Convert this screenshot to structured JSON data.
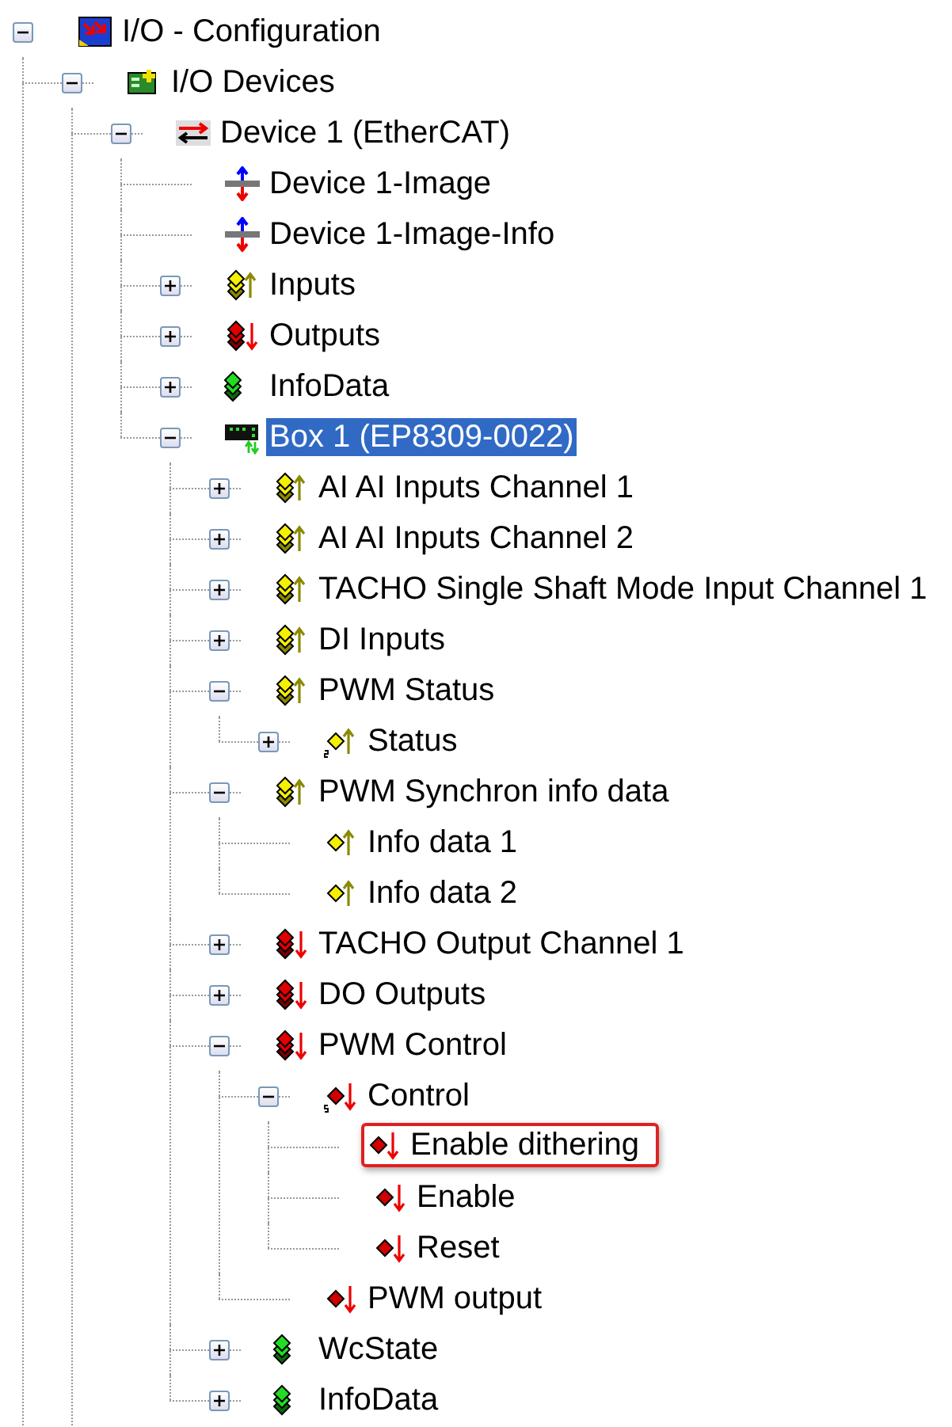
{
  "tree": [
    {
      "label": "I/O - Configuration",
      "kind": "config",
      "expanded": true,
      "selected": false,
      "children": [
        {
          "label": "I/O Devices",
          "kind": "devices",
          "expanded": true,
          "selected": false,
          "children": [
            {
              "label": "Device 1 (EtherCAT)",
              "kind": "ethercat",
              "expanded": true,
              "selected": false,
              "children": [
                {
                  "label": "Device 1-Image",
                  "kind": "image",
                  "selected": false
                },
                {
                  "label": "Device 1-Image-Info",
                  "kind": "image",
                  "selected": false
                },
                {
                  "label": "Inputs",
                  "kind": "inputs",
                  "expanded": false,
                  "selected": false
                },
                {
                  "label": "Outputs",
                  "kind": "outputs",
                  "expanded": false,
                  "selected": false
                },
                {
                  "label": "InfoData",
                  "kind": "info",
                  "expanded": false,
                  "selected": false
                },
                {
                  "label": "Box 1 (EP8309-0022)",
                  "kind": "box",
                  "expanded": true,
                  "selected": true,
                  "children": [
                    {
                      "label": "AI AI Inputs Channel 1",
                      "kind": "inputs",
                      "expanded": false,
                      "selected": false
                    },
                    {
                      "label": "AI AI Inputs Channel 2",
                      "kind": "inputs",
                      "expanded": false,
                      "selected": false
                    },
                    {
                      "label": "TACHO Single Shaft Mode Input Channel 1",
                      "kind": "inputs",
                      "expanded": false,
                      "selected": false
                    },
                    {
                      "label": "DI Inputs",
                      "kind": "inputs",
                      "expanded": false,
                      "selected": false
                    },
                    {
                      "label": "PWM Status",
                      "kind": "inputs",
                      "expanded": true,
                      "selected": false,
                      "children": [
                        {
                          "label": "Status",
                          "kind": "input_struct",
                          "expanded": false,
                          "selected": false
                        }
                      ]
                    },
                    {
                      "label": "PWM Synchron info data",
                      "kind": "inputs",
                      "expanded": true,
                      "selected": false,
                      "children": [
                        {
                          "label": "Info data 1",
                          "kind": "input_var",
                          "selected": false
                        },
                        {
                          "label": "Info data 2",
                          "kind": "input_var",
                          "selected": false
                        }
                      ]
                    },
                    {
                      "label": "TACHO Output Channel 1",
                      "kind": "outputs",
                      "expanded": false,
                      "selected": false
                    },
                    {
                      "label": "DO Outputs",
                      "kind": "outputs",
                      "expanded": false,
                      "selected": false
                    },
                    {
                      "label": "PWM Control",
                      "kind": "outputs",
                      "expanded": true,
                      "selected": false,
                      "children": [
                        {
                          "label": "Control",
                          "kind": "output_struct",
                          "expanded": true,
                          "selected": false,
                          "children": [
                            {
                              "label": "Enable dithering",
                              "kind": "output_var",
                              "selected": false,
                              "marked": true
                            },
                            {
                              "label": "Enable",
                              "kind": "output_var",
                              "selected": false
                            },
                            {
                              "label": "Reset",
                              "kind": "output_var",
                              "selected": false
                            }
                          ]
                        },
                        {
                          "label": "PWM output",
                          "kind": "output_var",
                          "selected": false
                        }
                      ]
                    },
                    {
                      "label": "WcState",
                      "kind": "info",
                      "expanded": false,
                      "selected": false
                    },
                    {
                      "label": "InfoData",
                      "kind": "info",
                      "expanded": false,
                      "selected": false
                    }
                  ]
                }
              ]
            }
          ]
        }
      ]
    }
  ]
}
